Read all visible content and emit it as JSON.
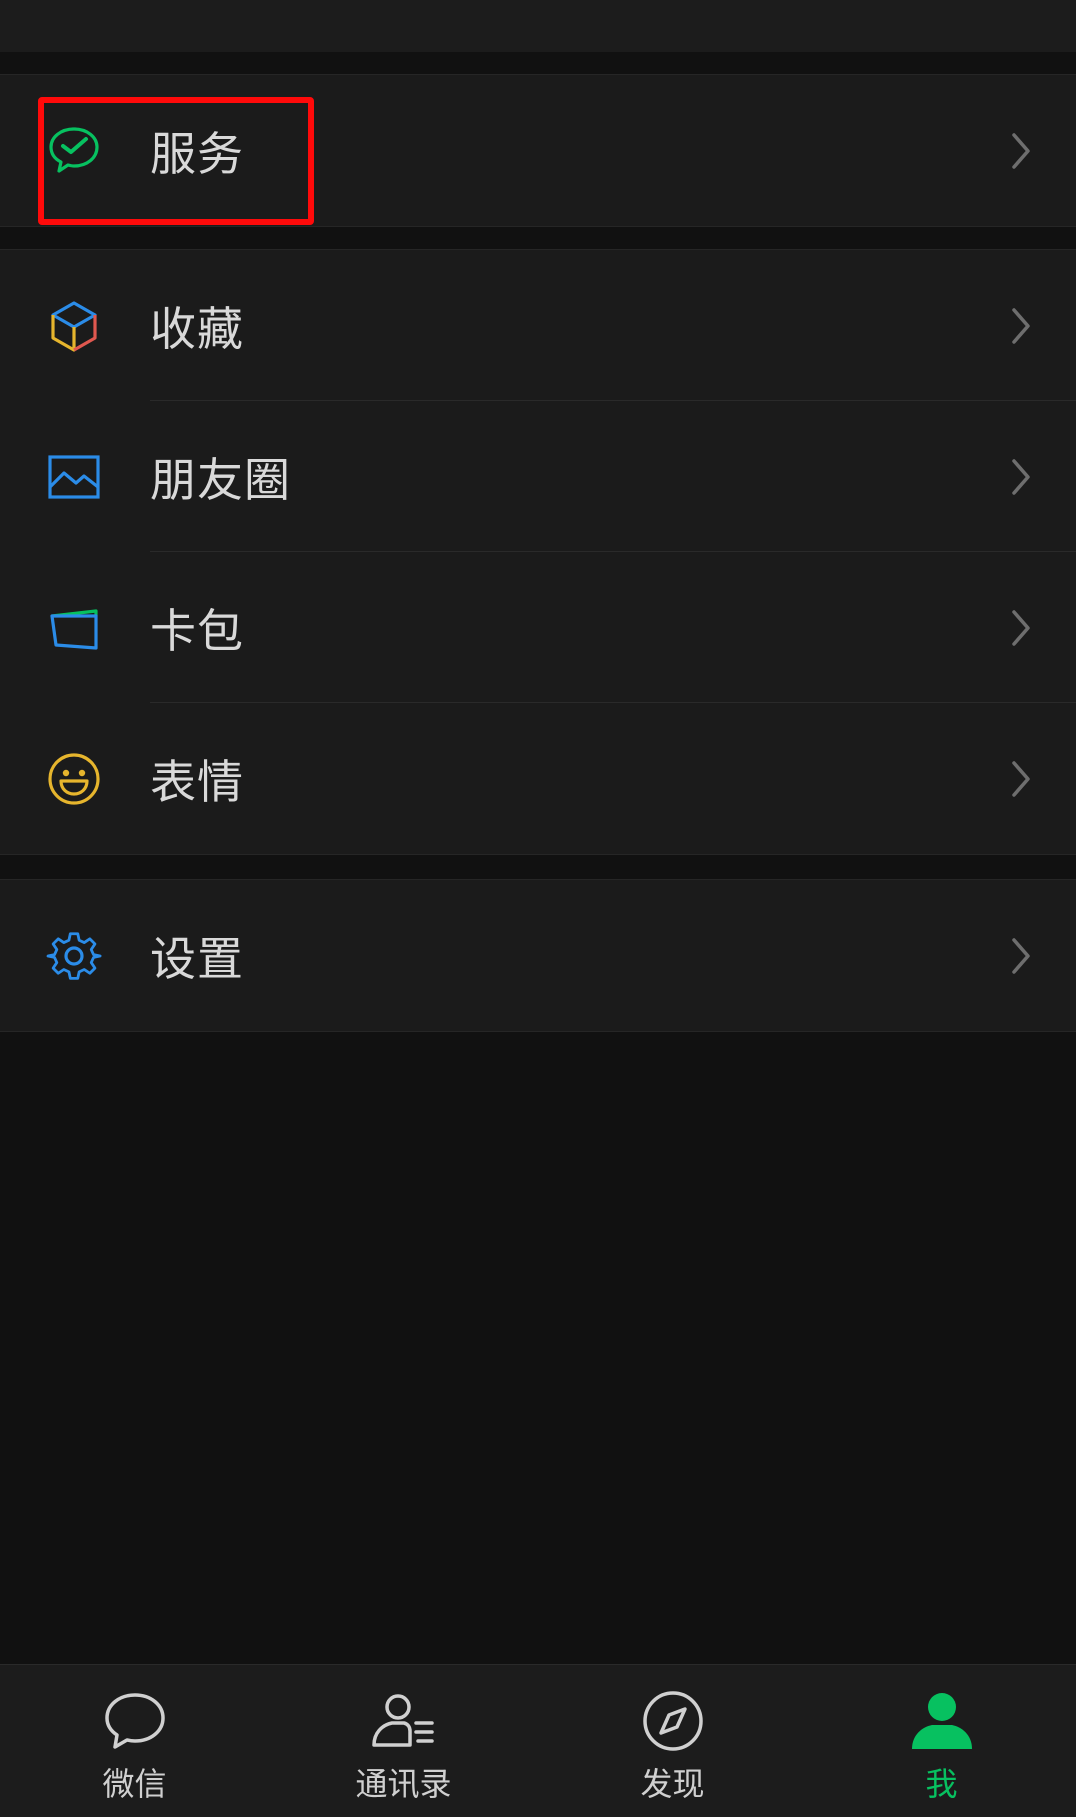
{
  "colors": {
    "accent": "#07c160",
    "highlight": "#ff0a0a",
    "icon_blue": "#2b8ce8",
    "icon_yellow": "#e6b52d",
    "icon_red": "#e0584f"
  },
  "menu": {
    "services": {
      "label": "服务",
      "icon": "wechat-pay-icon"
    },
    "favorites": {
      "label": "收藏",
      "icon": "cube-icon"
    },
    "moments": {
      "label": "朋友圈",
      "icon": "image-icon"
    },
    "cards": {
      "label": "卡包",
      "icon": "wallet-icon"
    },
    "stickers": {
      "label": "表情",
      "icon": "smiley-icon"
    },
    "settings": {
      "label": "设置",
      "icon": "gear-icon"
    }
  },
  "tabbar": {
    "tabs": [
      {
        "label": "微信",
        "icon": "chat-bubble-icon",
        "active": false
      },
      {
        "label": "通讯录",
        "icon": "contacts-icon",
        "active": false
      },
      {
        "label": "发现",
        "icon": "compass-icon",
        "active": false
      },
      {
        "label": "我",
        "icon": "person-icon",
        "active": true
      }
    ]
  }
}
